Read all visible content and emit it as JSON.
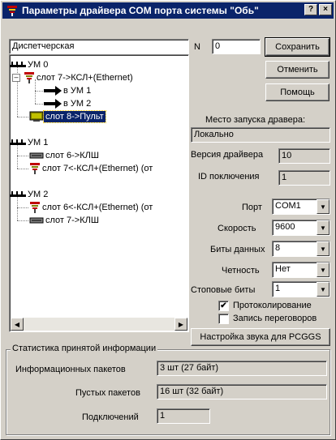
{
  "window": {
    "title": "Параметры драйвера COM порта системы \"Обь\"",
    "help_btn": "?",
    "close_btn": "×"
  },
  "left": {
    "name_value": "Диспетчерская"
  },
  "tree": [
    {
      "label": "УМ  0",
      "icon": "bus-icon"
    },
    {
      "label": "слот  7->КСЛ+(Ethernet)",
      "icon": "slot-icon",
      "expander": "⊟"
    },
    {
      "label": "в УМ  1",
      "icon": "arrow-right-icon"
    },
    {
      "label": "в УМ  2",
      "icon": "arrow-right-icon"
    },
    {
      "label": "слот  8->Пульт",
      "icon": "console-icon",
      "selected": true
    },
    {
      "label": "УМ  1",
      "icon": "bus-icon"
    },
    {
      "label": "слот  6->КЛШ",
      "icon": "cable-icon"
    },
    {
      "label": "слот  7<-КСЛ+(Ethernet) (от",
      "icon": "slot-icon"
    },
    {
      "label": "УМ  2",
      "icon": "bus-icon"
    },
    {
      "label": "слот  6<-КСЛ+(Ethernet) (от",
      "icon": "slot-icon"
    },
    {
      "label": "слот  7->КЛШ",
      "icon": "cable-icon"
    }
  ],
  "right": {
    "n_label": "N",
    "n_value": "0",
    "save_label": "Сохранить",
    "cancel_label": "Отменить",
    "help_label": "Помощь",
    "launch_place_label": "Место запуска дравера:",
    "launch_place_value": "Локально",
    "driver_version_label": "Версия драйвера",
    "driver_version_value": "10",
    "connection_id_label": "ID поключения",
    "connection_id_value": "1",
    "port_label": "Порт",
    "port_value": "COM1",
    "speed_label": "Скорость",
    "speed_value": "9600",
    "data_bits_label": "Биты данных",
    "data_bits_value": "8",
    "parity_label": "Четность",
    "parity_value": "Нет",
    "stop_bits_label": "Стоповые биты",
    "stop_bits_value": "1",
    "logging_label": "Протоколирование",
    "logging_checked": true,
    "record_label": "Запись переговоров",
    "record_checked": false,
    "sound_btn_label": "Настройка звука для PCGGS"
  },
  "stats": {
    "group_label": "Статистика принятой информации",
    "info_packets_label": "Информационных пакетов",
    "info_packets_value": "3 шт (27 байт)",
    "empty_packets_label": "Пустых пакетов",
    "empty_packets_value": "16 шт (32 байт)",
    "connections_label": "Подключений",
    "connections_value": "1"
  }
}
